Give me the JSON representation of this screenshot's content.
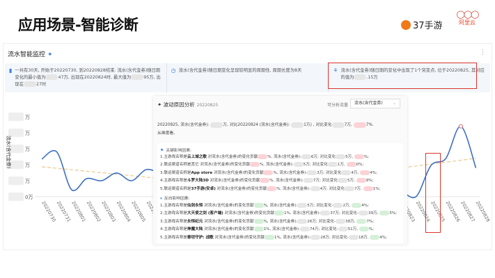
{
  "slide_title": "应用场景-智能诊断",
  "logos": {
    "brand1": "37手游",
    "brand2": "阿里云"
  },
  "monitor": {
    "title": "流水智能监控",
    "more_icon": "more-vertical-icon",
    "insights": [
      {
        "icon": "bar-chart-icon",
        "parts": [
          {
            "t": "一共有30天, 开始于20220730, 到20220828结束. 流水(含代金券)随日期变化的最小值为"
          },
          {
            "m": "gray"
          },
          {
            "t": "47万, 出现在20220824时, 最大值为"
          },
          {
            "m": "gray"
          },
          {
            "t": "95万, 出现在"
          },
          {
            "m": "gray"
          },
          {
            "t": "27时"
          }
        ]
      },
      {
        "icon": "clock-icon",
        "parts": [
          {
            "t": "流水(含代金券)随日期变化呈现较明显的周期性, 周期长度为8天"
          }
        ]
      },
      {
        "icon": "anomaly-icon",
        "parts": [
          {
            "t": "流水(含代金券)随日期的变化中出现了1个突变点, 位于20220825, 其对应的值为"
          },
          {
            "m": "gray"
          },
          {
            "t": ".15万"
          }
        ]
      }
    ],
    "highlight_color": "#d9352b"
  },
  "chart_data": {
    "type": "line",
    "ylabel": "流水(含代金券)",
    "x": [
      "20220730",
      "20220731",
      "20220801",
      "20220802",
      "20220803",
      "20220804",
      "20220805",
      "20220806",
      "20220807",
      "20220808",
      "20220809",
      "20220810",
      "20220811",
      "20220812",
      "20220813",
      "20220814",
      "20220815",
      "20220816",
      "20220817",
      "20220818",
      "20220819",
      "20220820",
      "20220821",
      "20220822",
      "20220823",
      "20220824",
      "20220825",
      "20220826",
      "20220827",
      "20220828"
    ],
    "ytick_suffixes": [
      "0万",
      "万",
      "万",
      "万",
      "万",
      "万"
    ],
    "ylim": [
      0,
      5
    ],
    "series": [
      {
        "color": "#3b6fc4",
        "values": [
          2.35,
          2.8,
          0.43,
          1.13,
          1.0,
          1.48,
          1.0,
          1.7,
          1.4,
          null,
          null,
          null,
          null,
          null,
          null,
          null,
          null,
          null,
          null,
          null,
          null,
          null,
          null,
          null,
          0.43,
          0.0,
          1.95,
          2.4,
          4.4,
          1.8
        ]
      }
    ],
    "trend": {
      "color": "#e8c98a",
      "style": "dashed",
      "values": [
        1.87,
        null,
        null,
        null,
        null,
        null,
        null,
        null,
        1.13,
        null,
        null,
        null,
        null,
        null,
        null,
        null,
        null,
        null,
        null,
        null,
        null,
        null,
        null,
        null,
        1.8,
        null,
        null,
        null,
        null,
        2.4
      ]
    },
    "highlight_date": "20220825",
    "max_marker": "20220827"
  },
  "analysis": {
    "title": "波动原因分析",
    "date": "20220825",
    "selector_label": "可分析流量",
    "selector_value": "流水(含代金券)",
    "summary1": [
      {
        "t": "20220825, 流水(含代金券): "
      },
      {
        "m": "gray"
      },
      {
        "t": "万, 对比20220824 (流水(含代金券): "
      },
      {
        "m": "gray"
      },
      {
        "t": "1万) , 对比变化"
      },
      {
        "m": "gray"
      },
      {
        "t": "7万, "
      },
      {
        "m": "pink"
      },
      {
        "t": "7%."
      }
    ],
    "summary2": "从维度看,",
    "positive_title": "关键影响因素:",
    "positive": [
      [
        {
          "t": "1.主游戏名称是"
        },
        {
          "b": "云上城之歌"
        },
        {
          "t": " 对流水(含代金券)的变化贡献"
        },
        {
          "m": "pink"
        },
        {
          "t": "%, 流水(含代金券):"
        },
        {
          "m": "gray"
        },
        {
          "t": "6万; 对比变化"
        },
        {
          "m": "gray"
        },
        {
          "t": "5万, "
        },
        {
          "m": "pink"
        },
        {
          "t": "%;"
        }
      ],
      [
        {
          "t": "2.联运渠道名称是其它 对流水(含代金券)的变化贡献"
        },
        {
          "m": "pink"
        },
        {
          "t": "%, 流水(含代金券):"
        },
        {
          "m": "gray"
        },
        {
          "t": "5万; 对比变化"
        },
        {
          "m": "gray"
        },
        {
          "t": "1万, "
        },
        {
          "m": "pink"
        },
        {
          "t": "0%;"
        }
      ],
      [
        {
          "t": "3.联运渠道名称是"
        },
        {
          "b": "App store"
        },
        {
          "t": " 对流水(含代金券)的变化贡献"
        },
        {
          "m": "pink"
        },
        {
          "t": "%, 流水(含代金券):"
        },
        {
          "m": "gray"
        },
        {
          "t": "3万; 对比变化"
        },
        {
          "m": "gray"
        },
        {
          "t": "4万, "
        },
        {
          "m": "pink"
        },
        {
          "t": "4%;"
        }
      ],
      [
        {
          "t": "4.主游戏名称是"
        },
        {
          "b": "斗罗大陆3D"
        },
        {
          "t": " 对流水(含代金券)的变化贡献"
        },
        {
          "m": "pink"
        },
        {
          "t": "%, 流水(含代金券):"
        },
        {
          "m": "gray"
        },
        {
          "t": "7万; 对比变化"
        },
        {
          "m": "gray"
        },
        {
          "t": "5万, "
        },
        {
          "m": "pink"
        },
        {
          "t": "9%;"
        }
      ],
      [
        {
          "t": "5.联运渠道名称是"
        },
        {
          "b": "37手游(安卓)"
        },
        {
          "t": " 对流水(含代金券)的变化贡献"
        },
        {
          "m": "pink"
        },
        {
          "t": "%, 流水(含代金券):"
        },
        {
          "m": "gray"
        },
        {
          "t": "4万; 对比变化"
        },
        {
          "m": "gray"
        },
        {
          "t": "7万, "
        },
        {
          "m": "pink"
        },
        {
          "t": "1%;"
        }
      ]
    ],
    "negative_title": "反向影响因素:",
    "negative": [
      [
        {
          "t": "1.主游戏名称是"
        },
        {
          "b": "仙剑永恒"
        },
        {
          "t": " 对流水(含代金券)的变化贡献"
        },
        {
          "m": "green"
        },
        {
          "t": "%, 流水(含代金券):"
        },
        {
          "m": "gray"
        },
        {
          "t": "5万; 对比变化-"
        },
        {
          "m": "gray"
        },
        {
          "t": "2万, "
        },
        {
          "m": "green"
        },
        {
          "t": "4%;"
        }
      ],
      [
        {
          "t": "2.主游戏名称是"
        },
        {
          "b": "大天使之剑 (客户端)"
        },
        {
          "t": " 对流水(含代金券)的变化贡献"
        },
        {
          "m": "green"
        },
        {
          "t": "1%, 流水(含代金券):"
        },
        {
          "m": "gray"
        },
        {
          "t": "37万; 对比变化-"
        },
        {
          "m": "gray"
        },
        {
          "t": "39万, "
        },
        {
          "m": "green"
        },
        {
          "t": "5%;"
        }
      ],
      [
        {
          "t": "3.主游戏名称是"
        },
        {
          "b": "永恒纪元"
        },
        {
          "t": " 对流水(含代金券)的变化贡献"
        },
        {
          "m": "green"
        },
        {
          "t": "%, 流水(含代金券):"
        },
        {
          "m": "gray"
        },
        {
          "t": "26万; 对比变化-"
        },
        {
          "m": "gray"
        },
        {
          "t": "38万, "
        },
        {
          "m": "green"
        },
        {
          "t": "7%;"
        }
      ],
      [
        {
          "t": "4.主游戏名称是"
        },
        {
          "b": "神魔大陆"
        },
        {
          "t": " 对流水(含代金券)的变化贡献"
        },
        {
          "m": "green"
        },
        {
          "t": "1%, 流水(含代金券):"
        },
        {
          "m": "gray"
        },
        {
          "t": "74万; 对比变化-"
        },
        {
          "m": "gray"
        },
        {
          "t": "51万, "
        },
        {
          "m": "green"
        },
        {
          "t": "%;"
        }
      ],
      [
        {
          "t": "5.主游戏名称是"
        },
        {
          "b": "泰坦守护: 战歌"
        },
        {
          "t": " 对流水(含代金券)的变化贡献"
        },
        {
          "m": "green"
        },
        {
          "t": "1%, 流水(含代金券):"
        },
        {
          "m": "gray"
        },
        {
          "t": "28万; 对比变化-"
        },
        {
          "m": "gray"
        },
        {
          "t": "18万, "
        },
        {
          "m": "green"
        },
        {
          "t": "4%;"
        }
      ]
    ]
  }
}
